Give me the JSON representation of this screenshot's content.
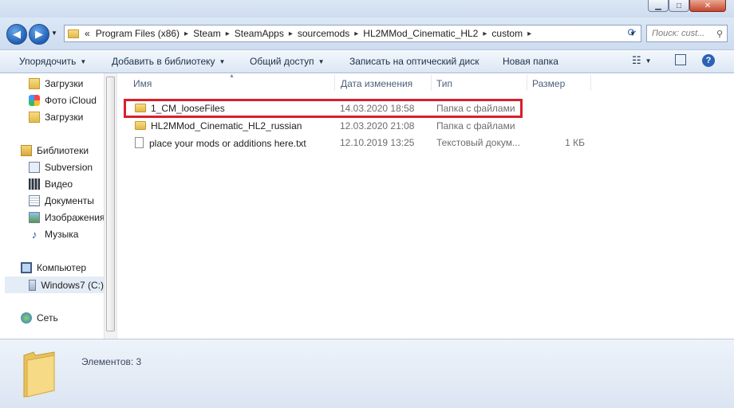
{
  "window": {
    "controls": {
      "minimize": "▁",
      "maximize": "□",
      "close": "✕"
    }
  },
  "address_bar": {
    "overflow": "«",
    "crumbs": [
      "Program Files (x86)",
      "Steam",
      "SteamApps",
      "sourcemods",
      "HL2MMod_Cinematic_HL2",
      "custom"
    ],
    "search_placeholder": "Поиск: cust..."
  },
  "command_bar": {
    "organize": "Упорядочить",
    "add_to_library": "Добавить в библиотеку",
    "share": "Общий доступ",
    "burn": "Записать на оптический диск",
    "new_folder": "Новая папка"
  },
  "nav_pane": {
    "items": [
      {
        "label": "Загрузки",
        "icon": "downloads-folder-icon"
      },
      {
        "label": "Фото iCloud",
        "icon": "icloud-photos-icon"
      },
      {
        "label": "Загрузки",
        "icon": "downloads-folder-icon"
      },
      {
        "label": "Библиотеки",
        "icon": "libraries-icon"
      },
      {
        "label": "Subversion",
        "icon": "library-icon"
      },
      {
        "label": "Видео",
        "icon": "video-library-icon"
      },
      {
        "label": "Документы",
        "icon": "documents-library-icon"
      },
      {
        "label": "Изображения",
        "icon": "pictures-library-icon"
      },
      {
        "label": "Музыка",
        "icon": "music-library-icon"
      },
      {
        "label": "Компьютер",
        "icon": "computer-icon"
      },
      {
        "label": "Windows7 (C:)",
        "icon": "drive-icon"
      },
      {
        "label": "Сеть",
        "icon": "network-icon"
      }
    ]
  },
  "file_list": {
    "columns": {
      "name": "Имя",
      "date": "Дата изменения",
      "type": "Тип",
      "size": "Размер"
    },
    "rows": [
      {
        "name": "1_CM_looseFiles",
        "date": "14.03.2020 18:58",
        "type": "Папка с файлами",
        "size": "",
        "icon": "folder-icon",
        "highlighted": true
      },
      {
        "name": "HL2MMod_Cinematic_HL2_russian",
        "date": "12.03.2020 21:08",
        "type": "Папка с файлами",
        "size": "",
        "icon": "folder-icon"
      },
      {
        "name": "place your mods or additions here.txt",
        "date": "12.10.2019 13:25",
        "type": "Текстовый докум...",
        "size": "1 КБ",
        "icon": "text-file-icon"
      }
    ]
  },
  "details_pane": {
    "status": "Элементов: 3"
  },
  "colors": {
    "highlight_border": "#d7202b",
    "folder": "#e2b84a"
  }
}
